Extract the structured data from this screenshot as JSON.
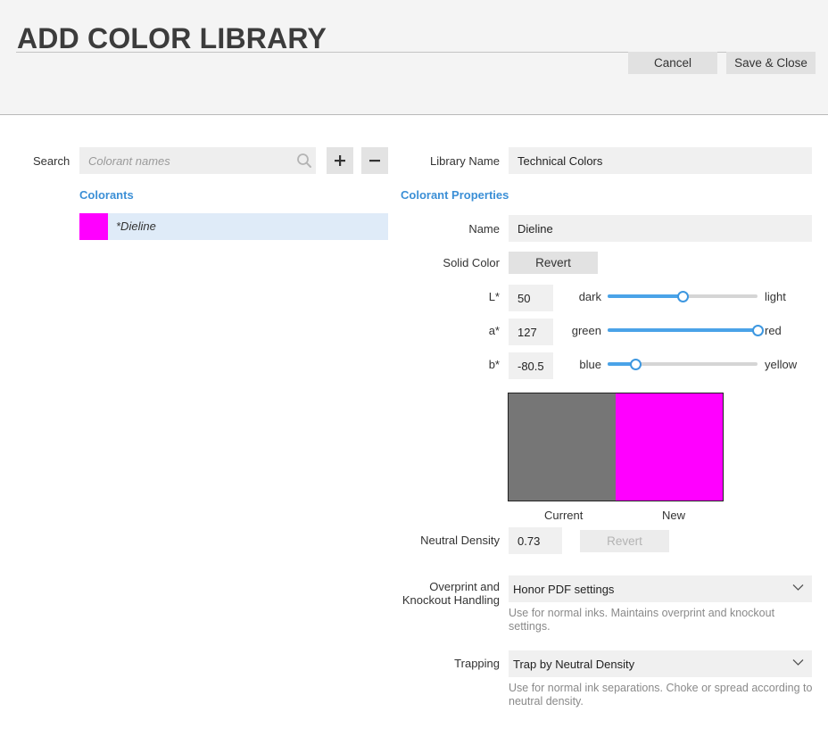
{
  "header": {
    "title": "ADD COLOR LIBRARY",
    "cancel_label": "Cancel",
    "save_label": "Save & Close"
  },
  "left": {
    "search_label": "Search",
    "search_placeholder": "Colorant names",
    "search_value": "",
    "add_icon": "plus-icon",
    "remove_icon": "minus-icon",
    "colorants_title": "Colorants",
    "colorants": [
      {
        "name": "*Dieline",
        "color": "#ff00ff",
        "selected": true
      }
    ]
  },
  "right": {
    "library_name_label": "Library Name",
    "library_name_value": "Technical Colors",
    "properties_title": "Colorant Properties",
    "name_label": "Name",
    "name_value": "Dieline",
    "solid_color_label": "Solid Color",
    "solid_revert_label": "Revert",
    "lab": [
      {
        "label": "L*",
        "value": "50",
        "low": "dark",
        "high": "light",
        "fraction": 0.5
      },
      {
        "label": "a*",
        "value": "127",
        "low": "green",
        "high": "red",
        "fraction": 1.0
      },
      {
        "label": "b*",
        "value": "-80.5",
        "low": "blue",
        "high": "yellow",
        "fraction": 0.185
      }
    ],
    "current_label": "Current",
    "new_label": "New",
    "current_color": "#767676",
    "new_color": "#ff00ff",
    "neutral_density_label": "Neutral Density",
    "neutral_density_value": "0.73",
    "nd_revert_label": "Revert",
    "overprint_label_1": "Overprint and",
    "overprint_label_2": "Knockout Handling",
    "overprint_value": "Honor PDF settings",
    "overprint_help": "Use for normal inks. Maintains overprint and knockout settings.",
    "trapping_label": "Trapping",
    "trapping_value": "Trap by Neutral Density",
    "trapping_help": "Use for normal ink separations. Choke or spread according to neutral density."
  },
  "colors": {
    "accent": "#3b8fd6",
    "slider": "#4aa3e8",
    "selected_row": "#dfebf8"
  }
}
